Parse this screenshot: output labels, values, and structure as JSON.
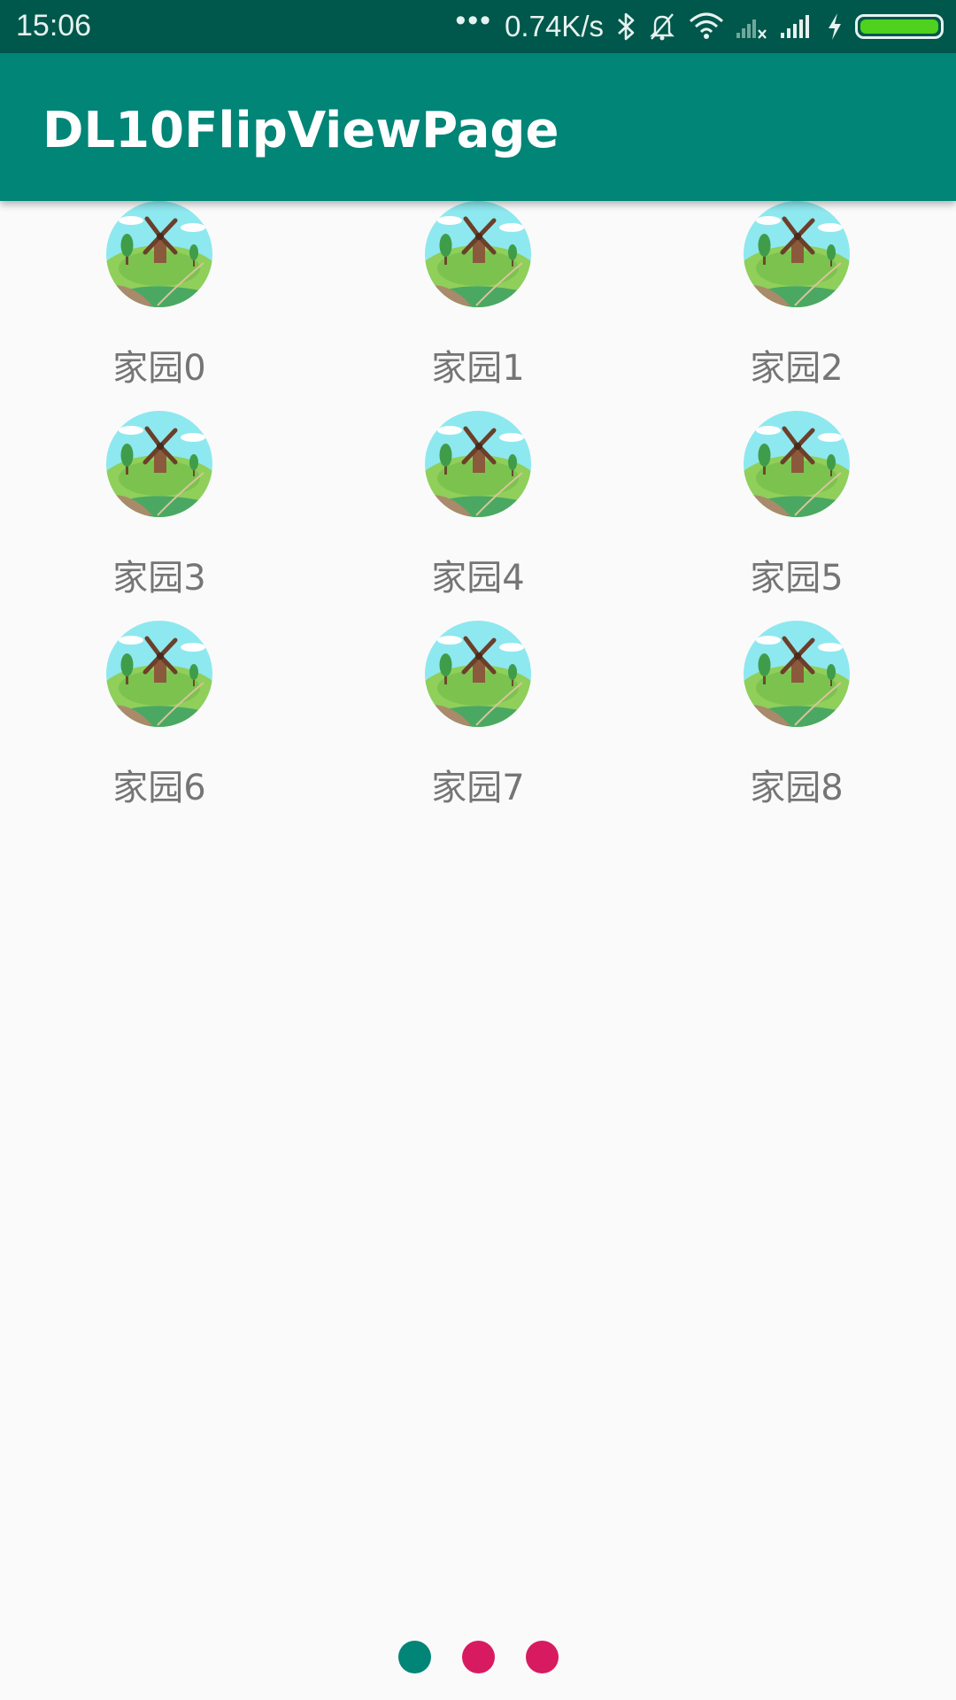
{
  "status_bar": {
    "time": "15:06",
    "net_speed": "0.74K/s",
    "more_dots": "•••",
    "icons": [
      "bluetooth-icon",
      "notifications-off-icon",
      "wifi-icon",
      "sim1-no-signal-icon",
      "signal-icon",
      "charging-icon",
      "battery-icon"
    ],
    "battery_level": 1.0
  },
  "toolbar": {
    "title": "DL10FlipViewPage"
  },
  "grid": {
    "icon": "windmill-landscape-icon",
    "items": [
      {
        "label": "家园0"
      },
      {
        "label": "家园1"
      },
      {
        "label": "家园2"
      },
      {
        "label": "家园3"
      },
      {
        "label": "家园4"
      },
      {
        "label": "家园5"
      },
      {
        "label": "家园6"
      },
      {
        "label": "家园7"
      },
      {
        "label": "家园8"
      }
    ]
  },
  "pager": {
    "page_count": 3,
    "current_page": 1,
    "active_color": "#008577",
    "inactive_color": "#d81b60"
  },
  "colors": {
    "primary": "#008577",
    "primary_dark": "#00574b",
    "accent": "#d81b60"
  }
}
